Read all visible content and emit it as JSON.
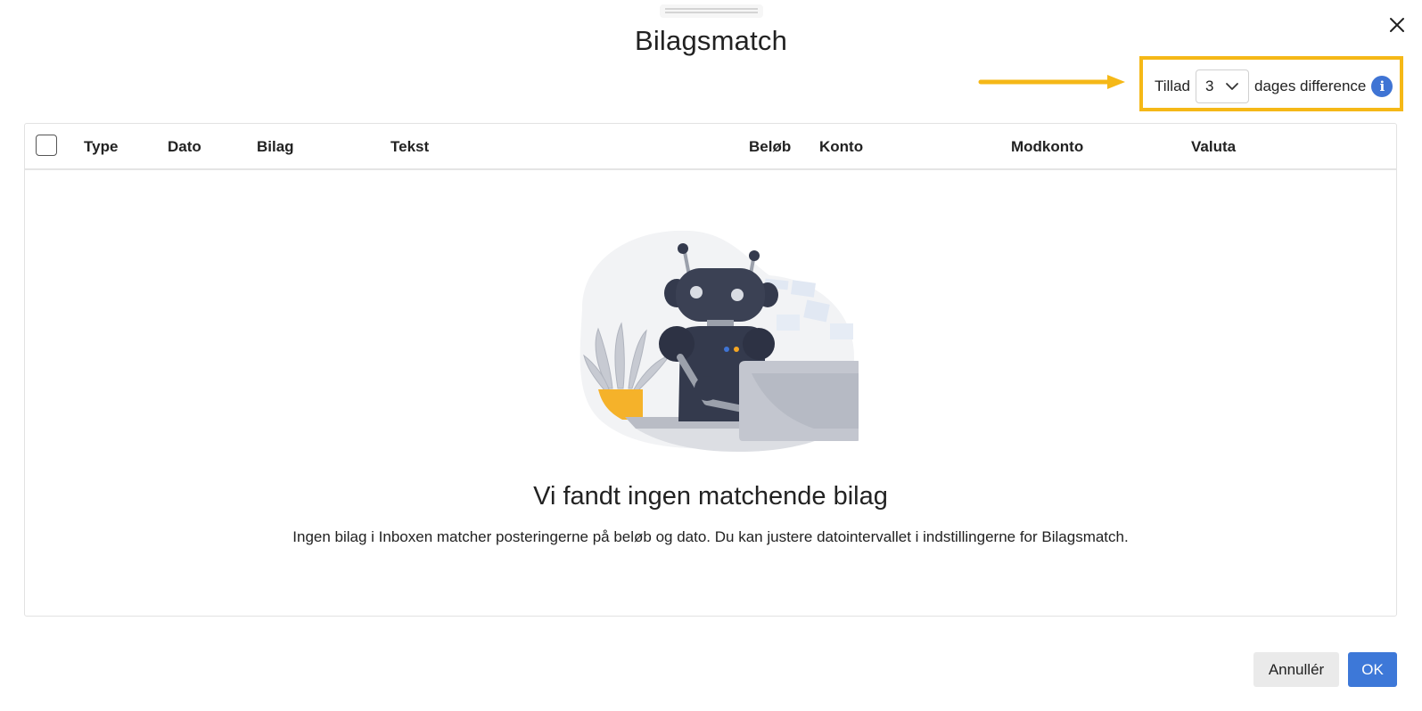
{
  "dialog": {
    "title": "Bilagsmatch"
  },
  "tolerance": {
    "label_before": "Tillad",
    "selected_days": "3",
    "label_after": "dages difference"
  },
  "table": {
    "columns": [
      "Type",
      "Dato",
      "Bilag",
      "Tekst",
      "Beløb",
      "Konto",
      "Modkonto",
      "Valuta"
    ]
  },
  "empty_state": {
    "title": "Vi fandt ingen matchende bilag",
    "description": "Ingen bilag i Inboxen matcher posteringerne på beløb og dato. Du kan justere datointervallet i indstillingerne for Bilagsmatch."
  },
  "footer": {
    "cancel_label": "Annullér",
    "ok_label": "OK"
  },
  "colors": {
    "highlight": "#f5b817",
    "primary": "#3d78d8",
    "info": "#3f74d4"
  },
  "icons": [
    "close-icon",
    "chevron-down-icon",
    "info-icon",
    "robot-illustration",
    "arrow-annotation"
  ]
}
